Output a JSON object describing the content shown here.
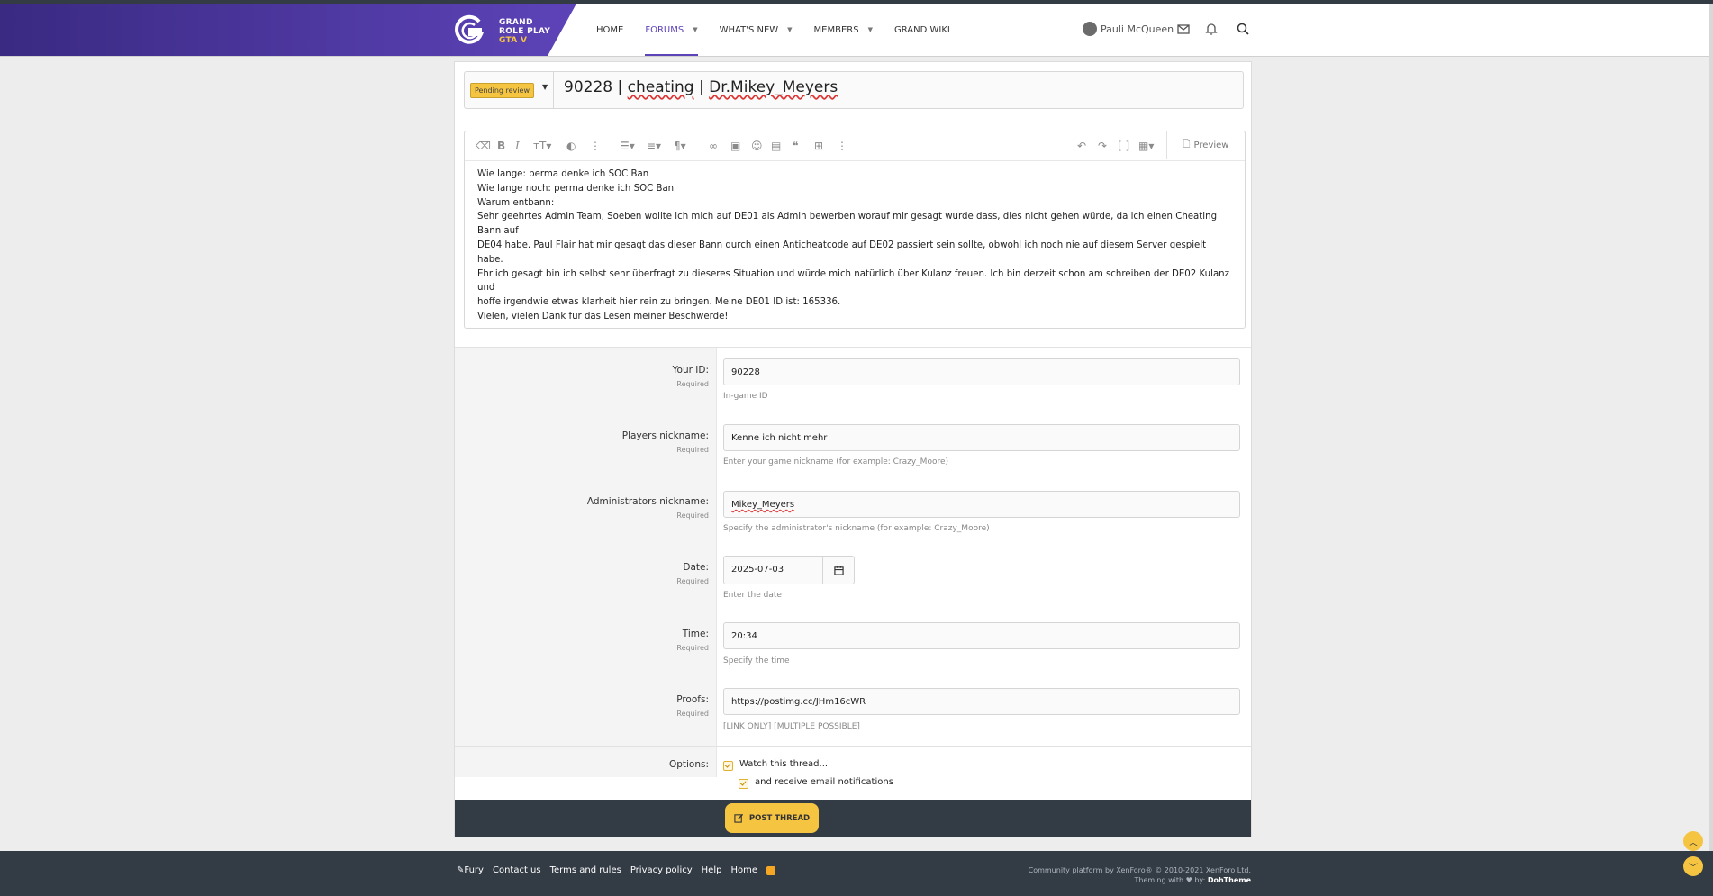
{
  "header": {
    "logo": {
      "line1": "GRAND",
      "line2": "ROLE PLAY",
      "line3": "GTA V"
    },
    "nav": [
      {
        "label": "HOME",
        "active": false,
        "dropdown": false
      },
      {
        "label": "FORUMS",
        "active": true,
        "dropdown": true
      },
      {
        "label": "WHAT'S NEW",
        "active": false,
        "dropdown": true
      },
      {
        "label": "MEMBERS",
        "active": false,
        "dropdown": true
      },
      {
        "label": "GRAND WIKI",
        "active": false,
        "dropdown": false
      }
    ],
    "username": "Pauli McQueen",
    "icons": [
      "envelope-icon",
      "bell-icon",
      "search-icon"
    ]
  },
  "thread": {
    "prefix": "Pending review",
    "title_parts": [
      "90228 | ",
      "cheating",
      " | ",
      "Dr.Mikey_Meyers"
    ]
  },
  "editor": {
    "preview_label": "Preview",
    "lines": [
      "Wie lange: perma denke ich SOC Ban",
      "Wie lange noch: perma denke ich SOC Ban",
      "Warum entbann:",
      "Sehr geehrtes Admin Team, Soeben wollte ich mich auf DE01 als Admin bewerben worauf mir gesagt wurde dass, dies nicht gehen würde, da ich einen Cheating Bann auf",
      "DE04 habe. Paul Flair hat mir gesagt das dieser Bann durch einen Anticheatcode auf DE02 passiert sein sollte, obwohl ich noch nie auf diesem Server gespielt habe.",
      "Ehrlich gesagt bin ich selbst sehr überfragt zu dieseres Situation und würde mich natürlich über Kulanz freuen. Ich bin derzeit schon am schreiben der DE02 Kulanz und",
      "hoffe irgendwie etwas klarheit hier rein zu bringen. Meine DE01 ID ist: 165336.",
      "Vielen, vielen Dank für das Lesen meiner Beschwerde!"
    ]
  },
  "form": {
    "required_text": "Required",
    "your_id": {
      "label": "Your ID:",
      "value": "90228",
      "hint": "In-game ID"
    },
    "players_nickname": {
      "label": "Players nickname:",
      "value": "Kenne ich nicht mehr",
      "hint": "Enter your game nickname (for example: Crazy_Moore)"
    },
    "admin_nickname": {
      "label": "Administrators nickname:",
      "value": "Mikey_Meyers",
      "hint": "Specify the administrator's nickname (for example: Crazy_Moore)"
    },
    "date": {
      "label": "Date:",
      "value": "2025-07-03",
      "hint": "Enter the date"
    },
    "time": {
      "label": "Time:",
      "value": "20:34",
      "hint": "Specify the time"
    },
    "proofs": {
      "label": "Proofs:",
      "value": "https://postimg.cc/JHm16cWR",
      "hint": "[LINK ONLY] [MULTIPLE POSSIBLE]"
    },
    "options": {
      "label": "Options:",
      "watch": "Watch this thread...",
      "email": "and receive email notifications"
    },
    "submit_label": "POST THREAD"
  },
  "footer": {
    "links": [
      "Fury",
      "Contact us",
      "Terms and rules",
      "Privacy policy",
      "Help",
      "Home"
    ],
    "copyright_line1": "Community platform by XenForo® © 2010-2021 XenForo Ltd.",
    "copyright_line2a": "Theming with",
    "copyright_line2b": "by:",
    "copyright_brand": "DohTheme"
  },
  "colors": {
    "brand_purple": "#5d43b8",
    "accent_yellow": "#f5c542",
    "dark_bar": "#333b45"
  }
}
